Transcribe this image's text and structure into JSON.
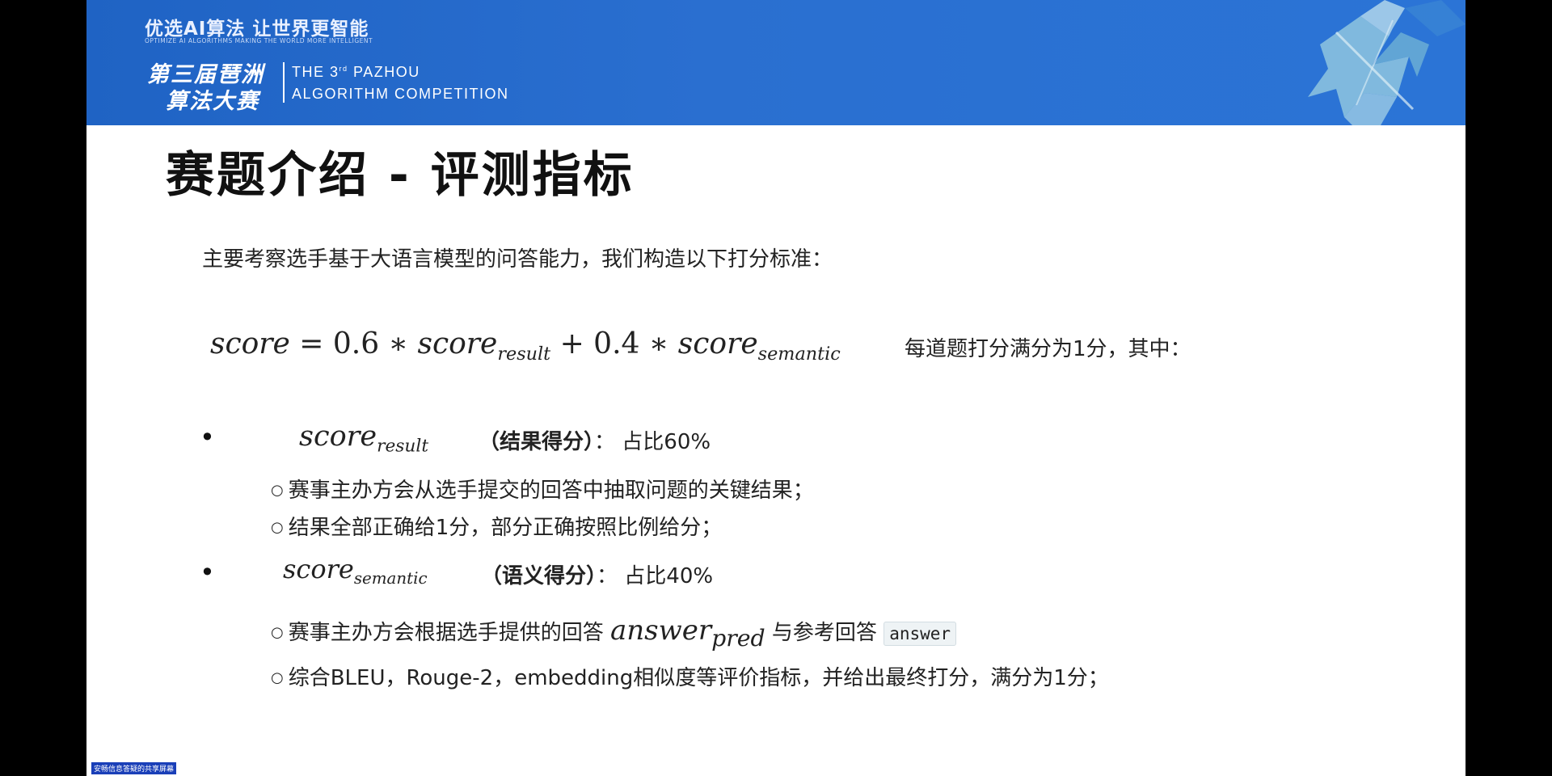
{
  "banner": {
    "slogan": "优选AI算法 让世界更智能",
    "slogan_en": "OPTIMIZE AI ALGORITHMS      MAKING THE WORLD MORE INTELLIGENT",
    "title_cn_line1": "第三届琶洲",
    "title_cn_line2": "算法大赛",
    "title_en_line1_pre": "THE 3",
    "title_en_line1_sup": "rd",
    "title_en_line1_post": " PAZHOU",
    "title_en_line2": "ALGORITHM COMPETITION"
  },
  "slide": {
    "title": "赛题介绍 - 评测指标",
    "intro": "主要考察选手基于大语言模型的问答能力，我们构造以下打分标准：",
    "formula": {
      "lhs": "score",
      "eq": " = 0.6 ∗ ",
      "t1": "score",
      "t1_sub": "result",
      "mid": " + 0.4 ∗ ",
      "t2": "score",
      "t2_sub": "semantic"
    },
    "formula_note": "每道题打分满分为1分，其中：",
    "bullets": [
      {
        "math": "score",
        "math_sub": "result",
        "label": "（结果得分）",
        "share": "：  占比60%",
        "items": [
          "赛事主办方会从选手提交的回答中抽取问题的关键结果；",
          "结果全部正确给1分，部分正确按照比例给分；"
        ]
      },
      {
        "math": "score",
        "math_sub": "semantic",
        "label": "（语义得分）",
        "share": "：  占比40%",
        "items": [
          {
            "pre": "赛事主办方会根据选手提供的回答 ",
            "math": "answer",
            "math_sub": "pred",
            "mid": " 与参考回答 ",
            "code": "answer"
          },
          "综合BLEU，Rouge-2，embedding相似度等评价指标，并给出最终打分，满分为1分；"
        ]
      }
    ]
  },
  "share_badge": "安畅信息答疑的共享屏幕",
  "colors": {
    "banner": "#2468c9",
    "accent": "#ffffff",
    "text": "#222222"
  },
  "icons": {
    "bullet": "bullet-dot-icon",
    "sub_bullet": "hollow-circle-icon"
  }
}
